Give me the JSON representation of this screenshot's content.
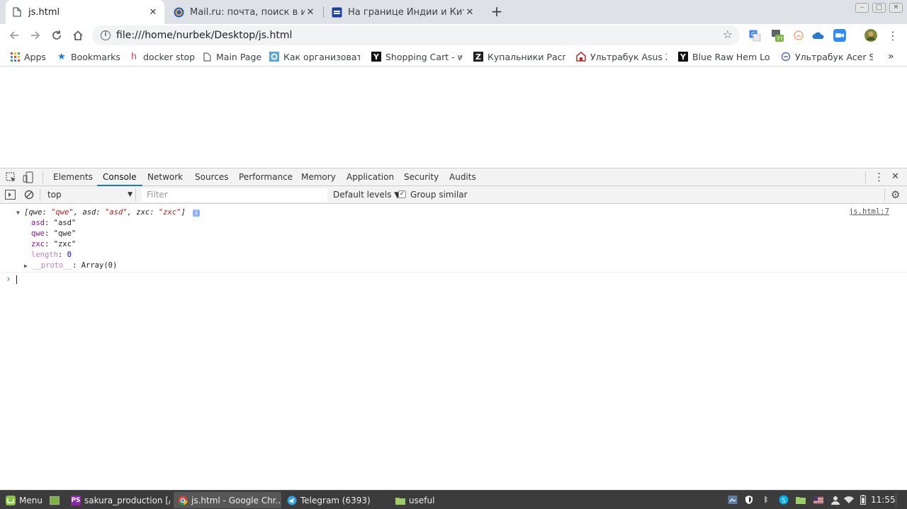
{
  "browser": {
    "tabs": [
      {
        "title": "js.html",
        "active": true
      },
      {
        "title": "Mail.ru: почта, поиск в интер",
        "active": false
      },
      {
        "title": "На границе Индии и Китая с",
        "active": false
      }
    ],
    "close_glyph": "✕",
    "new_tab_glyph": "+",
    "url": "file:///home/nurbek/Desktop/js.html",
    "extension_badge": "77"
  },
  "bookmarks": [
    {
      "label": "Apps",
      "icon": "apps-grid-icon"
    },
    {
      "label": "Bookmarks",
      "icon": "star-icon"
    },
    {
      "label": "docker stop",
      "icon": "h-icon"
    },
    {
      "label": "Main Page",
      "icon": "page-icon"
    },
    {
      "label": "Как организовать",
      "icon": "gear-favicon"
    },
    {
      "label": "Shopping Cart - w",
      "icon": "y-icon"
    },
    {
      "label": "Купальники Расп",
      "icon": "z-icon"
    },
    {
      "label": "Ультрабук Asus Z",
      "icon": "shop-icon"
    },
    {
      "label": "Blue Raw Hem Lov",
      "icon": "y-icon"
    },
    {
      "label": "Ультрабук Acer Sp",
      "icon": "shop-icon"
    }
  ],
  "bookmarks_overflow": "»",
  "devtools": {
    "tabs": [
      "Elements",
      "Console",
      "Network",
      "Sources",
      "Performance",
      "Memory",
      "Application",
      "Security",
      "Audits"
    ],
    "active_tab": "Console",
    "context": "top",
    "filter_placeholder": "Filter",
    "levels": "Default levels ▼",
    "group_similar": "Group similar",
    "console": {
      "summary": {
        "open": "[",
        "pairs": [
          {
            "k": "qwe",
            "v": "\"qwe\""
          },
          {
            "k": "asd",
            "v": "\"asd\""
          },
          {
            "k": "zxc",
            "v": "\"zxc\""
          }
        ],
        "close": "]",
        "badge": "i"
      },
      "source": "js.html:7",
      "props": [
        {
          "k": "asd",
          "v": "\"asd\"",
          "type": "str"
        },
        {
          "k": "qwe",
          "v": "\"qwe\"",
          "type": "str"
        },
        {
          "k": "zxc",
          "v": "\"zxc\"",
          "type": "str"
        },
        {
          "k": "length",
          "v": "0",
          "type": "num"
        }
      ],
      "proto": {
        "k": "__proto__",
        "v": "Array(0)"
      },
      "prompt": "›"
    }
  },
  "taskbar": {
    "menu": "Menu",
    "items": [
      {
        "label": "sakura_production [/...",
        "active": false
      },
      {
        "label": "js.html - Google Chr...",
        "active": true
      },
      {
        "label": "Telegram (6393)",
        "active": false
      },
      {
        "label": "useful",
        "active": false
      }
    ],
    "clock": "11:55"
  },
  "colors": {
    "accent": "#1a73e8",
    "tabstrip": "#dee1e6",
    "taskbar": "#3c3c3c",
    "console_key": "#881391",
    "console_string": "#c41a16",
    "console_number": "#1c00cf"
  }
}
